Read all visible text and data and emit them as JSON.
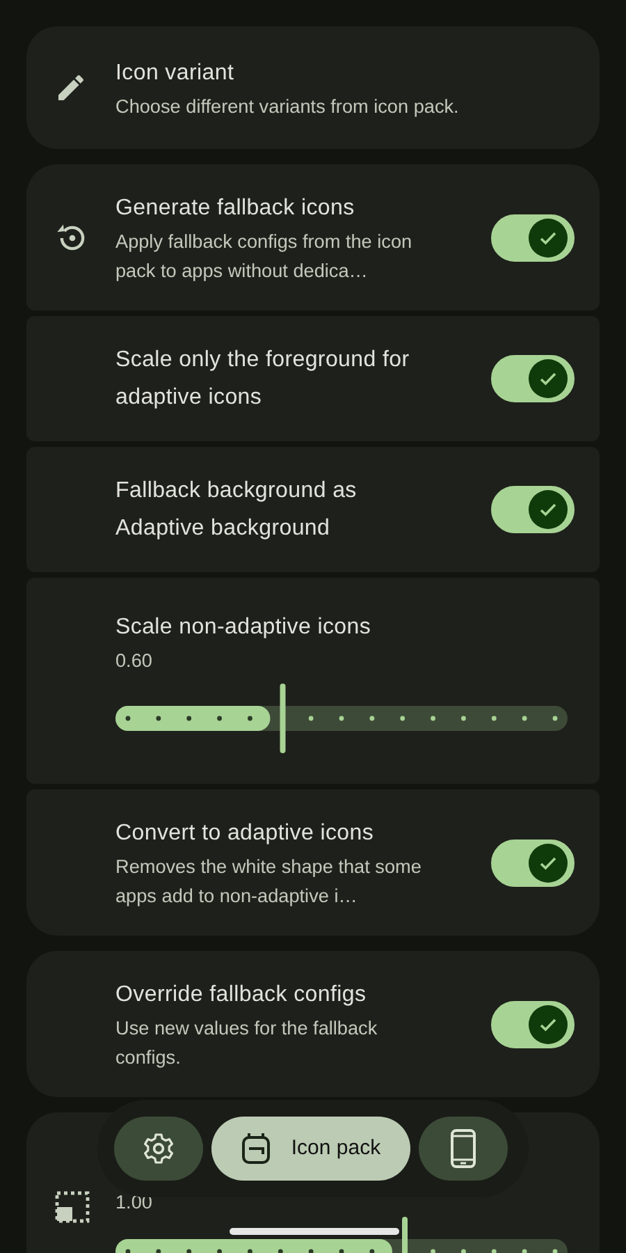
{
  "sections": [
    {
      "items": [
        {
          "kind": "link",
          "title": "Icon variant",
          "subtitle": "Choose different variants from icon pack."
        }
      ]
    },
    {
      "items": [
        {
          "kind": "switch",
          "title": "Generate fallback icons",
          "subtitle": "Apply fallback configs from the icon pack to apps without dedica…",
          "on": true
        },
        {
          "kind": "switch",
          "title": "Scale only the foreground for adaptive icons",
          "on": true
        },
        {
          "kind": "switch",
          "title": "Fallback background as Adaptive background",
          "on": true
        },
        {
          "kind": "slider",
          "title": "Scale non-adaptive icons",
          "value": "0.60",
          "level": 0.37
        },
        {
          "kind": "switch",
          "title": "Convert to adaptive icons",
          "subtitle": "Removes the white shape that some apps add to non-adaptive i…",
          "on": true
        }
      ]
    },
    {
      "items": [
        {
          "kind": "switch",
          "title": "Override fallback configs",
          "subtitle": "Use new values for the fallback configs.",
          "on": true
        }
      ]
    },
    {
      "items": [
        {
          "kind": "slider",
          "value": "1.00",
          "level": 0.64
        }
      ]
    }
  ],
  "nav": [
    {
      "selected": false
    },
    {
      "label": "Icon pack",
      "selected": true
    },
    {
      "selected": false
    }
  ]
}
